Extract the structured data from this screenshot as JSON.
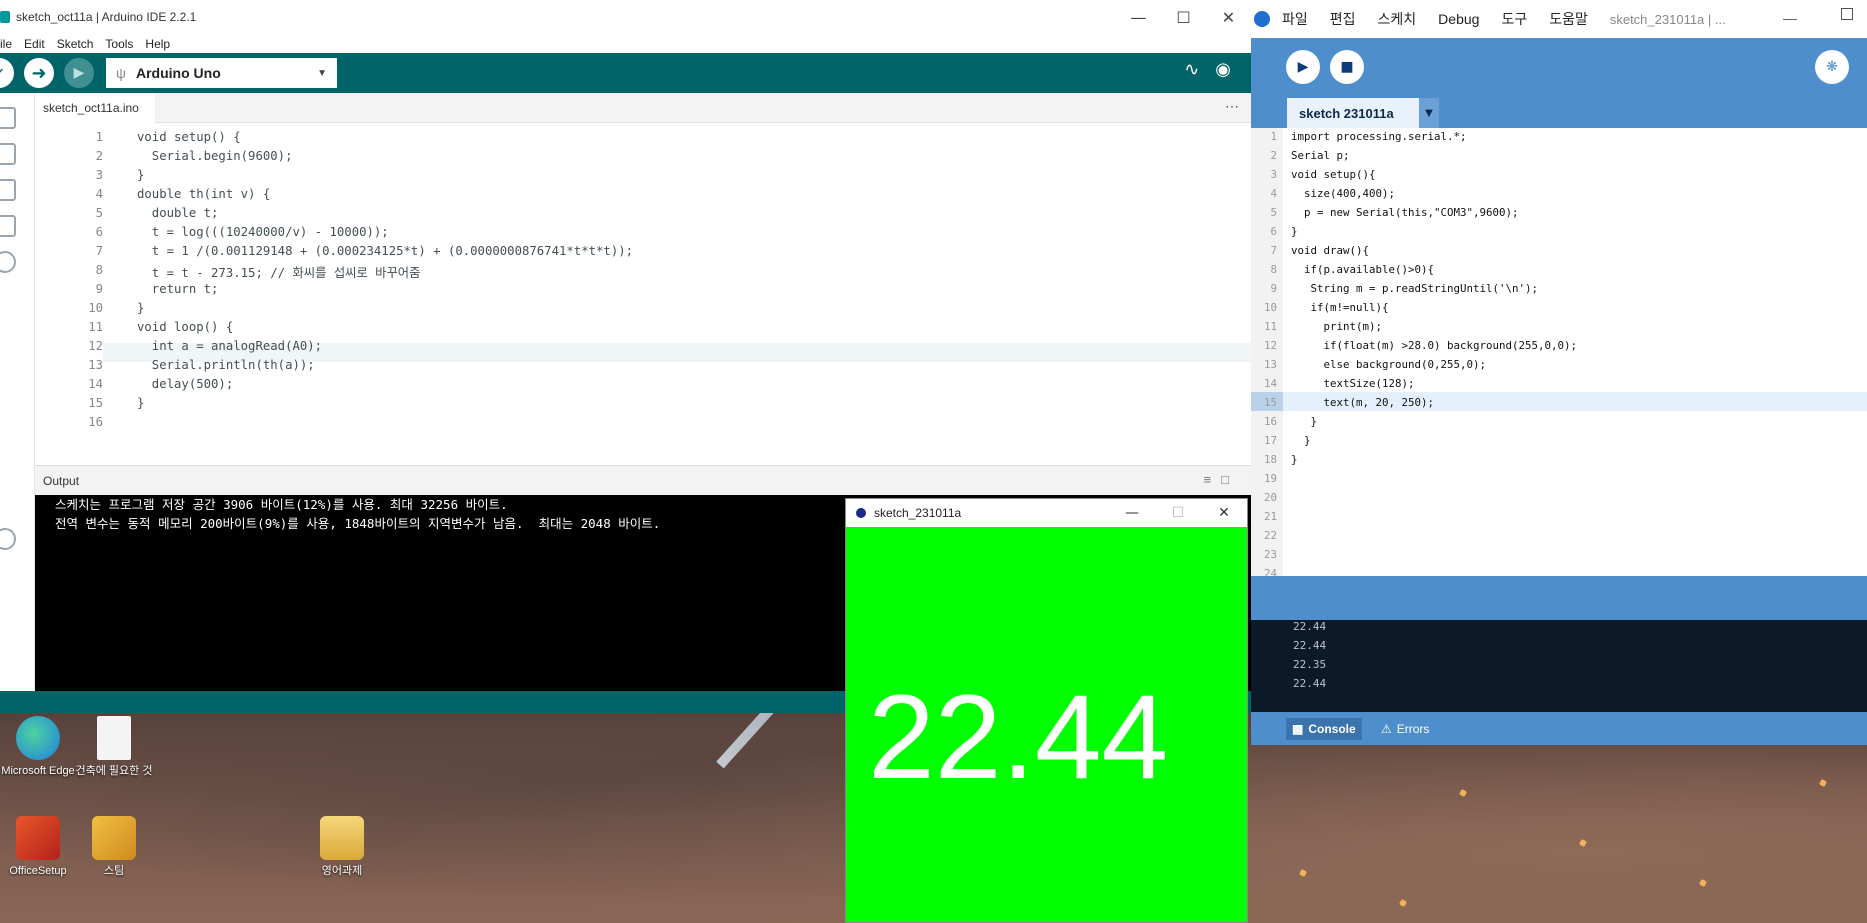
{
  "arduino": {
    "title": "sketch_oct11a | Arduino IDE 2.2.1",
    "menu": [
      "ile",
      "Edit",
      "Sketch",
      "Tools",
      "Help"
    ],
    "board": "Arduino Uno",
    "tab": "sketch_oct11a.ino",
    "code_lines": [
      "void setup() {",
      "  Serial.begin(9600);",
      "}",
      "double th(int v) {",
      "  double t;",
      "  t = log(((10240000/v) - 10000));",
      "  t = 1 /(0.001129148 + (0.000234125*t) + (0.0000000876741*t*t*t));",
      "  t = t - 273.15; // 화씨를 섭씨로 바꾸어줌",
      "  return t;",
      "}",
      "void loop() {",
      "  int a = analogRead(A0);",
      "  Serial.println(th(a));",
      "  delay(500);",
      "}",
      ""
    ],
    "line_numbers": [
      "1",
      "2",
      "3",
      "4",
      "5",
      "6",
      "7",
      "8",
      "9",
      "10",
      "11",
      "12",
      "13",
      "14",
      "15",
      "16"
    ],
    "output_label": "Output",
    "console": [
      "스케치는 프로그램 저장 공간 3906 바이트(12%)를 사용. 최대 32256 바이트.",
      "전역 변수는 동적 메모리 200바이트(9%)를 사용, 1848바이트의 지역변수가 남음.  최대는 2048 바이트."
    ]
  },
  "processing": {
    "menu": [
      "파일",
      "편집",
      "스케치",
      "Debug",
      "도구",
      "도움말"
    ],
    "window_title": "sketch_231011a | ...",
    "tab": "sketch 231011a",
    "code_lines": [
      "import processing.serial.*;",
      "Serial p;",
      "void setup(){",
      "  size(400,400);",
      "  p = new Serial(this,\"COM3\",9600);",
      "}",
      "void draw(){",
      "  if(p.available()>0){",
      "   String m = p.readStringUntil('\\n');",
      "   if(m!=null){",
      "     print(m);",
      "     if(float(m) >28.0) background(255,0,0);",
      "     else background(0,255,0);",
      "     textSize(128);",
      "     text(m, 20, 250);",
      "   }",
      "  }",
      "}",
      "",
      "",
      "",
      "",
      "",
      ""
    ],
    "line_numbers": [
      "1",
      "2",
      "3",
      "4",
      "5",
      "6",
      "7",
      "8",
      "9",
      "10",
      "11",
      "12",
      "13",
      "14",
      "15",
      "16",
      "17",
      "18",
      "19",
      "20",
      "21",
      "22",
      "23",
      "24"
    ],
    "console": [
      "22.44",
      "22.44",
      "22.35",
      "22.44"
    ],
    "console_tab": "Console",
    "errors_tab": "Errors"
  },
  "sketch_window": {
    "title": "sketch_231011a",
    "display": "22.44",
    "background": "#00ff00"
  },
  "desktop": {
    "icons": [
      {
        "label": "Microsoft Edge"
      },
      {
        "label": "건축에 필요한 것"
      },
      {
        "label": "OfficeSetup"
      },
      {
        "label": "스팀"
      },
      {
        "label": "영어과제"
      }
    ]
  }
}
